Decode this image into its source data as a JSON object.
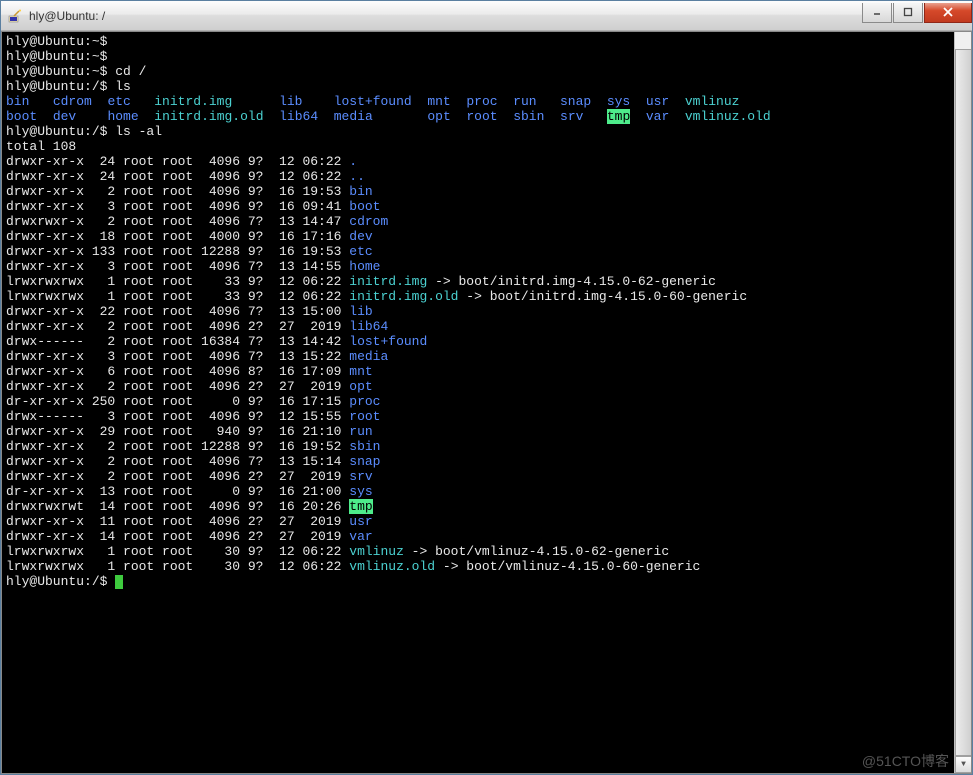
{
  "window": {
    "title": "hly@Ubuntu: /"
  },
  "watermark": "@51CTO博客",
  "terminal": {
    "lines": [
      {
        "segs": [
          {
            "t": "hly@Ubuntu:~$",
            "c": "c-w"
          }
        ]
      },
      {
        "segs": [
          {
            "t": "hly@Ubuntu:~$",
            "c": "c-w"
          }
        ]
      },
      {
        "segs": [
          {
            "t": "hly@Ubuntu:~$ cd /",
            "c": "c-w"
          }
        ]
      },
      {
        "segs": [
          {
            "t": "hly@Ubuntu:/$ ls",
            "c": "c-w"
          }
        ]
      },
      {
        "segs": [
          {
            "t": "bin",
            "c": "c-b"
          },
          {
            "t": "   "
          },
          {
            "t": "cdrom",
            "c": "c-b"
          },
          {
            "t": "  "
          },
          {
            "t": "etc",
            "c": "c-b"
          },
          {
            "t": "   "
          },
          {
            "t": "initrd.img",
            "c": "c-c"
          },
          {
            "t": "      "
          },
          {
            "t": "lib",
            "c": "c-b"
          },
          {
            "t": "    "
          },
          {
            "t": "lost+found",
            "c": "c-b"
          },
          {
            "t": "  "
          },
          {
            "t": "mnt",
            "c": "c-b"
          },
          {
            "t": "  "
          },
          {
            "t": "proc",
            "c": "c-b"
          },
          {
            "t": "  "
          },
          {
            "t": "run",
            "c": "c-b"
          },
          {
            "t": "   "
          },
          {
            "t": "snap",
            "c": "c-b"
          },
          {
            "t": "  "
          },
          {
            "t": "sys",
            "c": "c-b"
          },
          {
            "t": "  "
          },
          {
            "t": "usr",
            "c": "c-b"
          },
          {
            "t": "  "
          },
          {
            "t": "vmlinuz",
            "c": "c-c"
          }
        ]
      },
      {
        "segs": [
          {
            "t": "boot",
            "c": "c-b"
          },
          {
            "t": "  "
          },
          {
            "t": "dev",
            "c": "c-b"
          },
          {
            "t": "    "
          },
          {
            "t": "home",
            "c": "c-b"
          },
          {
            "t": "  "
          },
          {
            "t": "initrd.img.old",
            "c": "c-c"
          },
          {
            "t": "  "
          },
          {
            "t": "lib64",
            "c": "c-b"
          },
          {
            "t": "  "
          },
          {
            "t": "media",
            "c": "c-b"
          },
          {
            "t": "       "
          },
          {
            "t": "opt",
            "c": "c-b"
          },
          {
            "t": "  "
          },
          {
            "t": "root",
            "c": "c-b"
          },
          {
            "t": "  "
          },
          {
            "t": "sbin",
            "c": "c-b"
          },
          {
            "t": "  "
          },
          {
            "t": "srv",
            "c": "c-b"
          },
          {
            "t": "   "
          },
          {
            "t": "tmp",
            "c": "hl-tmp"
          },
          {
            "t": "  "
          },
          {
            "t": "var",
            "c": "c-b"
          },
          {
            "t": "  "
          },
          {
            "t": "vmlinuz.old",
            "c": "c-c"
          }
        ]
      },
      {
        "segs": [
          {
            "t": "hly@Ubuntu:/$ ls -al",
            "c": "c-w"
          }
        ]
      },
      {
        "segs": [
          {
            "t": "total 108",
            "c": "c-w"
          }
        ]
      },
      {
        "segs": [
          {
            "t": "drwxr-xr-x  24 root root  4096 9?  12 06:22 ",
            "c": "c-w"
          },
          {
            "t": ".",
            "c": "c-b"
          }
        ]
      },
      {
        "segs": [
          {
            "t": "drwxr-xr-x  24 root root  4096 9?  12 06:22 ",
            "c": "c-w"
          },
          {
            "t": "..",
            "c": "c-b"
          }
        ]
      },
      {
        "segs": [
          {
            "t": "drwxr-xr-x   2 root root  4096 9?  16 19:53 ",
            "c": "c-w"
          },
          {
            "t": "bin",
            "c": "c-b"
          }
        ]
      },
      {
        "segs": [
          {
            "t": "drwxr-xr-x   3 root root  4096 9?  16 09:41 ",
            "c": "c-w"
          },
          {
            "t": "boot",
            "c": "c-b"
          }
        ]
      },
      {
        "segs": [
          {
            "t": "drwxrwxr-x   2 root root  4096 7?  13 14:47 ",
            "c": "c-w"
          },
          {
            "t": "cdrom",
            "c": "c-b"
          }
        ]
      },
      {
        "segs": [
          {
            "t": "drwxr-xr-x  18 root root  4000 9?  16 17:16 ",
            "c": "c-w"
          },
          {
            "t": "dev",
            "c": "c-b"
          }
        ]
      },
      {
        "segs": [
          {
            "t": "drwxr-xr-x 133 root root 12288 9?  16 19:53 ",
            "c": "c-w"
          },
          {
            "t": "etc",
            "c": "c-b"
          }
        ]
      },
      {
        "segs": [
          {
            "t": "drwxr-xr-x   3 root root  4096 7?  13 14:55 ",
            "c": "c-w"
          },
          {
            "t": "home",
            "c": "c-b"
          }
        ]
      },
      {
        "segs": [
          {
            "t": "lrwxrwxrwx   1 root root    33 9?  12 06:22 ",
            "c": "c-w"
          },
          {
            "t": "initrd.img",
            "c": "c-c"
          },
          {
            "t": " -> boot/initrd.img-4.15.0-62-generic",
            "c": "c-w"
          }
        ]
      },
      {
        "segs": [
          {
            "t": "lrwxrwxrwx   1 root root    33 9?  12 06:22 ",
            "c": "c-w"
          },
          {
            "t": "initrd.img.old",
            "c": "c-c"
          },
          {
            "t": " -> boot/initrd.img-4.15.0-60-generic",
            "c": "c-w"
          }
        ]
      },
      {
        "segs": [
          {
            "t": "drwxr-xr-x  22 root root  4096 7?  13 15:00 ",
            "c": "c-w"
          },
          {
            "t": "lib",
            "c": "c-b"
          }
        ]
      },
      {
        "segs": [
          {
            "t": "drwxr-xr-x   2 root root  4096 2?  27  2019 ",
            "c": "c-w"
          },
          {
            "t": "lib64",
            "c": "c-b"
          }
        ]
      },
      {
        "segs": [
          {
            "t": "drwx------   2 root root 16384 7?  13 14:42 ",
            "c": "c-w"
          },
          {
            "t": "lost+found",
            "c": "c-b"
          }
        ]
      },
      {
        "segs": [
          {
            "t": "drwxr-xr-x   3 root root  4096 7?  13 15:22 ",
            "c": "c-w"
          },
          {
            "t": "media",
            "c": "c-b"
          }
        ]
      },
      {
        "segs": [
          {
            "t": "drwxr-xr-x   6 root root  4096 8?  16 17:09 ",
            "c": "c-w"
          },
          {
            "t": "mnt",
            "c": "c-b"
          }
        ]
      },
      {
        "segs": [
          {
            "t": "drwxr-xr-x   2 root root  4096 2?  27  2019 ",
            "c": "c-w"
          },
          {
            "t": "opt",
            "c": "c-b"
          }
        ]
      },
      {
        "segs": [
          {
            "t": "dr-xr-xr-x 250 root root     0 9?  16 17:15 ",
            "c": "c-w"
          },
          {
            "t": "proc",
            "c": "c-b"
          }
        ]
      },
      {
        "segs": [
          {
            "t": "drwx------   3 root root  4096 9?  12 15:55 ",
            "c": "c-w"
          },
          {
            "t": "root",
            "c": "c-b"
          }
        ]
      },
      {
        "segs": [
          {
            "t": "drwxr-xr-x  29 root root   940 9?  16 21:10 ",
            "c": "c-w"
          },
          {
            "t": "run",
            "c": "c-b"
          }
        ]
      },
      {
        "segs": [
          {
            "t": "drwxr-xr-x   2 root root 12288 9?  16 19:52 ",
            "c": "c-w"
          },
          {
            "t": "sbin",
            "c": "c-b"
          }
        ]
      },
      {
        "segs": [
          {
            "t": "drwxr-xr-x   2 root root  4096 7?  13 15:14 ",
            "c": "c-w"
          },
          {
            "t": "snap",
            "c": "c-b"
          }
        ]
      },
      {
        "segs": [
          {
            "t": "drwxr-xr-x   2 root root  4096 2?  27  2019 ",
            "c": "c-w"
          },
          {
            "t": "srv",
            "c": "c-b"
          }
        ]
      },
      {
        "segs": [
          {
            "t": "dr-xr-xr-x  13 root root     0 9?  16 21:00 ",
            "c": "c-w"
          },
          {
            "t": "sys",
            "c": "c-b"
          }
        ]
      },
      {
        "segs": [
          {
            "t": "drwxrwxrwt  14 root root  4096 9?  16 20:26 ",
            "c": "c-w"
          },
          {
            "t": "tmp",
            "c": "hl-tmp"
          }
        ]
      },
      {
        "segs": [
          {
            "t": "drwxr-xr-x  11 root root  4096 2?  27  2019 ",
            "c": "c-w"
          },
          {
            "t": "usr",
            "c": "c-b"
          }
        ]
      },
      {
        "segs": [
          {
            "t": "drwxr-xr-x  14 root root  4096 2?  27  2019 ",
            "c": "c-w"
          },
          {
            "t": "var",
            "c": "c-b"
          }
        ]
      },
      {
        "segs": [
          {
            "t": "lrwxrwxrwx   1 root root    30 9?  12 06:22 ",
            "c": "c-w"
          },
          {
            "t": "vmlinuz",
            "c": "c-c"
          },
          {
            "t": " -> boot/vmlinuz-4.15.0-62-generic",
            "c": "c-w"
          }
        ]
      },
      {
        "segs": [
          {
            "t": "lrwxrwxrwx   1 root root    30 9?  12 06:22 ",
            "c": "c-w"
          },
          {
            "t": "vmlinuz.old",
            "c": "c-c"
          },
          {
            "t": " -> boot/vmlinuz-4.15.0-60-generic",
            "c": "c-w"
          }
        ]
      },
      {
        "segs": [
          {
            "t": "hly@Ubuntu:/$ ",
            "c": "c-w"
          }
        ],
        "cursor": true
      }
    ]
  }
}
